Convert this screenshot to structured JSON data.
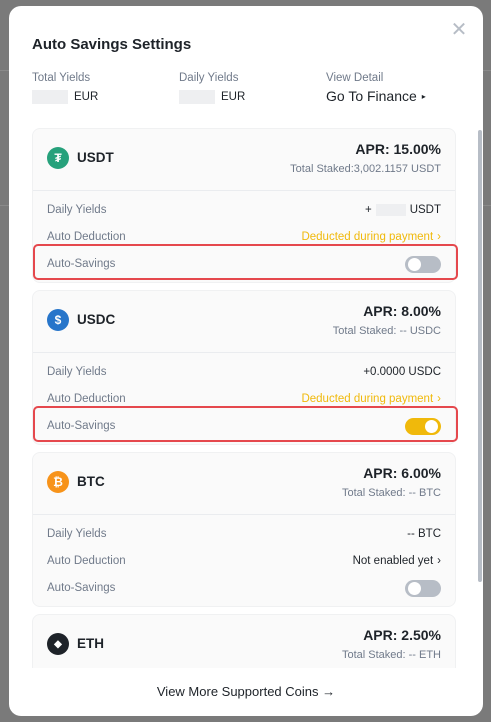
{
  "modal": {
    "title": "Auto Savings Settings",
    "close_icon": "close-icon"
  },
  "summary": {
    "total_yields_label": "Total Yields",
    "total_yields_unit": "EUR",
    "daily_yields_label": "Daily Yields",
    "daily_yields_unit": "EUR",
    "view_detail_label": "View Detail",
    "go_finance_label": "Go To Finance",
    "go_finance_caret": "▸"
  },
  "coins": [
    {
      "name": "USDT",
      "icon": "usdt-icon",
      "icon_glyph": "₮",
      "icon_color": "#26a17b",
      "apr": "APR: 15.00%",
      "staked": "Total Staked:3,002.1157 USDT",
      "daily_yields_label": "Daily Yields",
      "daily_yields_prefix": "+",
      "daily_yields_value": "USDT",
      "auto_deduction_label": "Auto Deduction",
      "auto_deduction_value": "Deducted during payment",
      "auto_deduction_chevron": "›",
      "auto_savings_label": "Auto-Savings",
      "auto_savings_on": false
    },
    {
      "name": "USDC",
      "icon": "usdc-icon",
      "icon_glyph": "$",
      "icon_color": "#2775ca",
      "apr": "APR: 8.00%",
      "staked": "Total Staked: -- USDC",
      "daily_yields_label": "Daily Yields",
      "daily_yields_value": "+0.0000 USDC",
      "auto_deduction_label": "Auto Deduction",
      "auto_deduction_value": "Deducted during payment",
      "auto_deduction_chevron": "›",
      "auto_savings_label": "Auto-Savings",
      "auto_savings_on": true
    },
    {
      "name": "BTC",
      "icon": "btc-icon",
      "icon_glyph": "₿",
      "icon_color": "#f7931a",
      "apr": "APR: 6.00%",
      "staked": "Total Staked: -- BTC",
      "daily_yields_label": "Daily Yields",
      "daily_yields_value": "-- BTC",
      "auto_deduction_label": "Auto Deduction",
      "auto_deduction_value": "Not enabled yet",
      "auto_deduction_chevron": "›",
      "auto_savings_label": "Auto-Savings",
      "auto_savings_on": false
    },
    {
      "name": "ETH",
      "icon": "eth-icon",
      "icon_glyph": "◆",
      "icon_color": "#1e2329",
      "apr": "APR: 2.50%",
      "staked": "Total Staked: -- ETH"
    }
  ],
  "footer": {
    "view_more_label": "View More Supported Coins →"
  },
  "colors": {
    "accent": "#f0b90b",
    "highlight": "#e5484d"
  }
}
